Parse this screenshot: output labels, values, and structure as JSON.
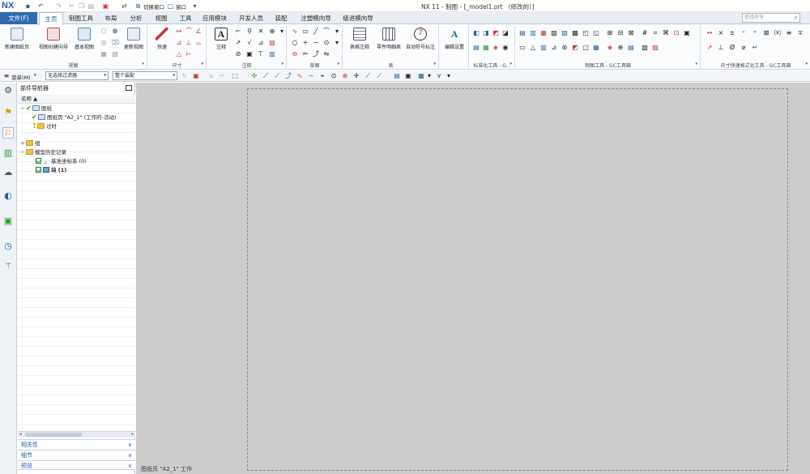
{
  "app": {
    "logo": "NX",
    "window_title": "NX 11 - 制图 - [_model1.prt （修改的）]"
  },
  "quick_access": {
    "switch_window": "切换窗口",
    "window_menu": "窗口"
  },
  "menu": {
    "file": "文件(F)",
    "tabs": [
      "主页",
      "制图工具",
      "布局",
      "分析",
      "视图",
      "工具",
      "应用模块",
      "开发人员",
      "装配",
      "注塑模向导",
      "级进模向导"
    ],
    "active_tab": "主页",
    "search_placeholder": "查找命令"
  },
  "ribbon": {
    "groups": [
      {
        "label": "视图",
        "buttons": [
          "新建图纸页",
          "视图创建向导",
          "基本视图",
          "更新视图"
        ]
      },
      {
        "label": "尺寸",
        "buttons": [
          "快速"
        ]
      },
      {
        "label": "注释",
        "buttons": [
          "注释"
        ]
      },
      {
        "label": "草图",
        "buttons": []
      },
      {
        "label": "表",
        "buttons": [
          "表格注释",
          "零件明细表",
          "自动符号标注"
        ]
      },
      {
        "label": "",
        "buttons": [
          "编辑设置"
        ]
      },
      {
        "label": "标准化工具 - G..."
      },
      {
        "label": "制图工具 - GC工具箱"
      },
      {
        "label": "尺寸快速格式化工具 - GC工具箱"
      }
    ]
  },
  "toolbar2": {
    "menu": "菜单(M)",
    "filter": "无选择过滤器",
    "scope": "整个装配"
  },
  "navigator": {
    "title": "部件导航器",
    "column": "名称",
    "tree": [
      {
        "label": "图纸",
        "level": 0
      },
      {
        "label": "图纸页 \"A2_1\" (工作的-活动)",
        "level": 1
      },
      {
        "label": "过时",
        "level": 1
      },
      {
        "label": "组",
        "level": 0
      },
      {
        "label": "模型历史记录",
        "level": 0
      },
      {
        "label": "基准坐标系 (0)",
        "level": 1
      },
      {
        "label": "块 (1)",
        "level": 1
      }
    ],
    "panels": [
      "相关性",
      "细节",
      "预览"
    ]
  },
  "canvas": {
    "status": "图纸页 \"A2_1\" 工作"
  },
  "colors": {
    "accent": "#2f6bae",
    "canvas_bg": "#cdcdcd"
  }
}
